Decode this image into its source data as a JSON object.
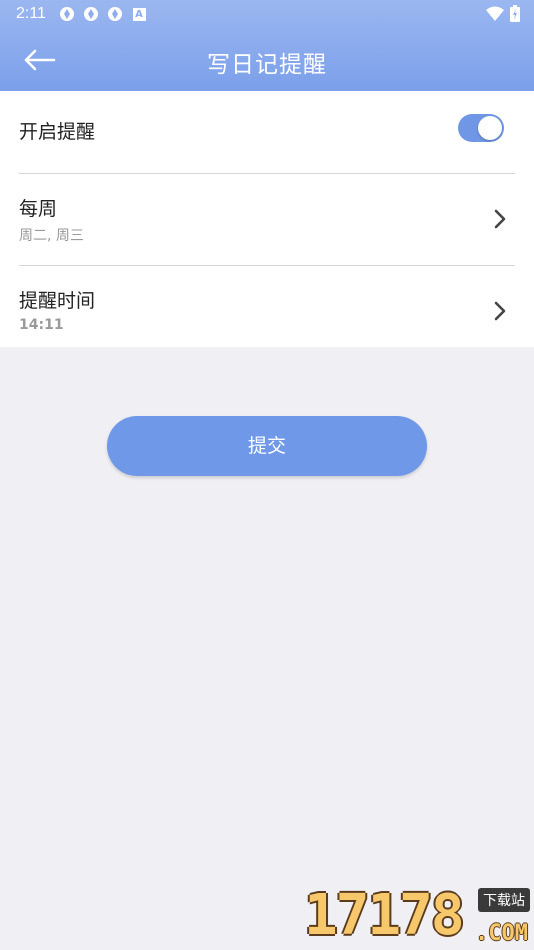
{
  "status_bar": {
    "time": "2:11",
    "notification_icons": [
      "sync-icon",
      "sync-icon",
      "sync-icon",
      "font-icon"
    ],
    "notification_letter": "A",
    "right_icons": [
      "wifi-icon",
      "battery-icon"
    ]
  },
  "header": {
    "title": "写日记提醒",
    "back_icon": "arrow-left-icon",
    "gradient_top": "#9bb7f0",
    "gradient_bottom": "#7b9fea"
  },
  "settings": {
    "enable": {
      "label": "开启提醒",
      "toggle_on": true
    },
    "repeat": {
      "label": "每周",
      "value": "周二, 周三"
    },
    "time": {
      "label": "提醒时间",
      "value": "14:11"
    }
  },
  "actions": {
    "submit_label": "提交"
  },
  "watermark": {
    "digits": "17178",
    "tag": "下载站",
    "suffix": ".COM"
  },
  "colors": {
    "accent": "#6f98e8",
    "background": "#efeff4"
  }
}
